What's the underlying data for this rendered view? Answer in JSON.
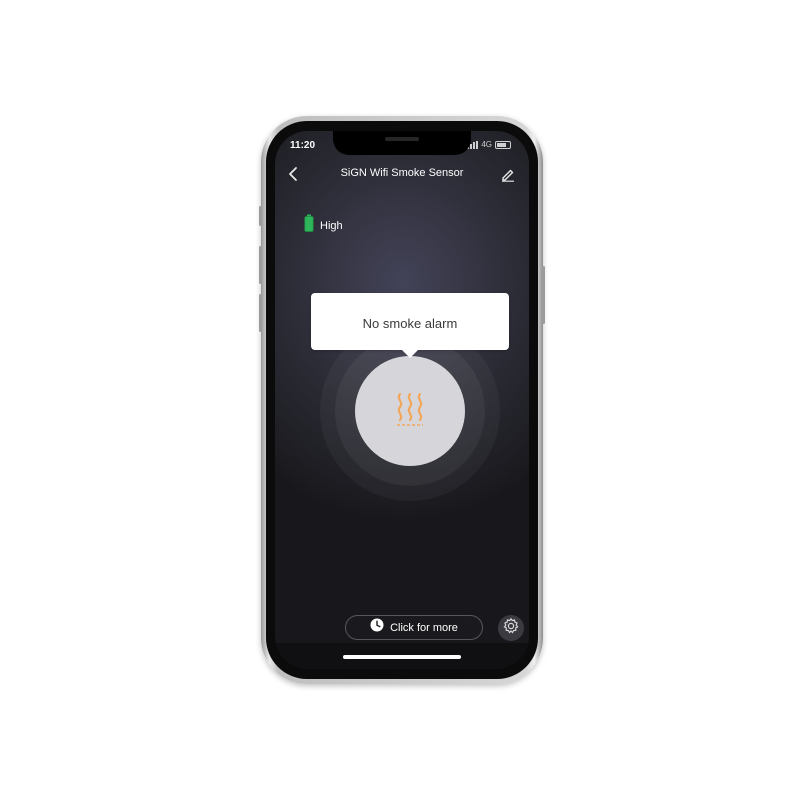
{
  "status_bar": {
    "time": "11:20",
    "network": "4G"
  },
  "header": {
    "title": "SiGN Wifi Smoke Sensor",
    "back_icon": "chevron-left-icon",
    "edit_icon": "pencil-icon"
  },
  "battery": {
    "label": "High",
    "icon": "battery-icon",
    "color": "#2fb55a"
  },
  "alarm": {
    "message": "No smoke alarm",
    "icon": "smoke-icon",
    "icon_color": "#f2a65a"
  },
  "actions": {
    "more_label": "Click for more",
    "more_icon": "clock-icon",
    "settings_icon": "gear-icon"
  }
}
